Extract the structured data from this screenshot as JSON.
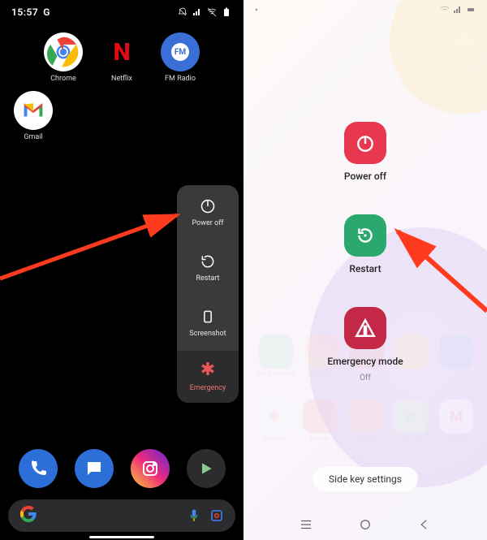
{
  "left_phone": {
    "status": {
      "time": "15:57",
      "carrier_letter": "G"
    },
    "apps_row1": [
      {
        "label": "Chrome",
        "bg": "#fff"
      },
      {
        "label": "Netflix",
        "bg": "#000"
      },
      {
        "label": "FM Radio",
        "bg": "#3a6fd8"
      }
    ],
    "apps_row2": [
      {
        "label": "Gmail",
        "bg": "#fff"
      }
    ],
    "power_menu": {
      "power_off": "Power off",
      "restart": "Restart",
      "screenshot": "Screenshot",
      "emergency": "Emergency"
    },
    "dock": [
      {
        "name": "phone",
        "bg": "#2d6fd8"
      },
      {
        "name": "messages",
        "bg": "#2d6fd8"
      },
      {
        "name": "instagram",
        "bg": "linear-gradient(45deg,#f9ce34,#ee2a7b,#6228d7)"
      },
      {
        "name": "play-games",
        "bg": "#2c2c2e"
      }
    ]
  },
  "right_phone": {
    "menu": {
      "power_off": "Power off",
      "restart": "Restart",
      "emergency": "Emergency mode",
      "emergency_sub": "Off"
    },
    "side_key": "Side key settings",
    "ghost_apps_top": [
      "WA Business",
      "Instagram",
      "",
      "",
      ""
    ],
    "ghost_apps": [
      "Camera",
      "Phone",
      "Clock",
      "Calendar",
      "Gmail"
    ],
    "colors": {
      "power_off": "#e8384f",
      "restart": "#2aa86e",
      "emergency": "#c42847"
    }
  }
}
